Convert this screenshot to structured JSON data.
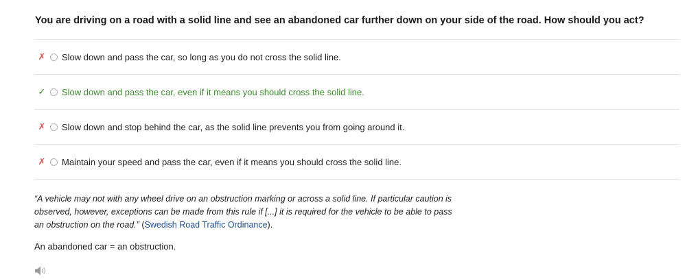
{
  "question": "You are driving on a road with a solid line and see an abandoned car further down on your side of the road. How should you act?",
  "answers": [
    {
      "mark": "✗",
      "text": "Slow down and pass the car, so long as you do not cross the solid line.",
      "correct": false
    },
    {
      "mark": "✓",
      "text": "Slow down and pass the car, even if it means you should cross the solid line.",
      "correct": true
    },
    {
      "mark": "✗",
      "text": "Slow down and stop behind the car, as the solid line prevents you from going around it.",
      "correct": false
    },
    {
      "mark": "✗",
      "text": "Maintain your speed and pass the car, even if it means you should cross the solid line.",
      "correct": false
    }
  ],
  "explanation": {
    "quote": "“A vehicle may not with any wheel drive on an obstruction marking or across a solid line. If particular caution is observed, however, exceptions can be made from this rule if [...] it is required for the vehicle to be able to pass an obstruction on the road.”",
    "source_open": " (",
    "source_link": "Swedish Road Traffic Ordinance",
    "source_close": ")."
  },
  "note": "An abandoned car = an obstruction.",
  "icons": {
    "audio": "speaker-icon",
    "wrong": "cross-icon",
    "right": "check-icon"
  },
  "colors": {
    "correct": "#3c8a2e",
    "wrong": "#d9534f",
    "link": "#1f4f8f"
  }
}
